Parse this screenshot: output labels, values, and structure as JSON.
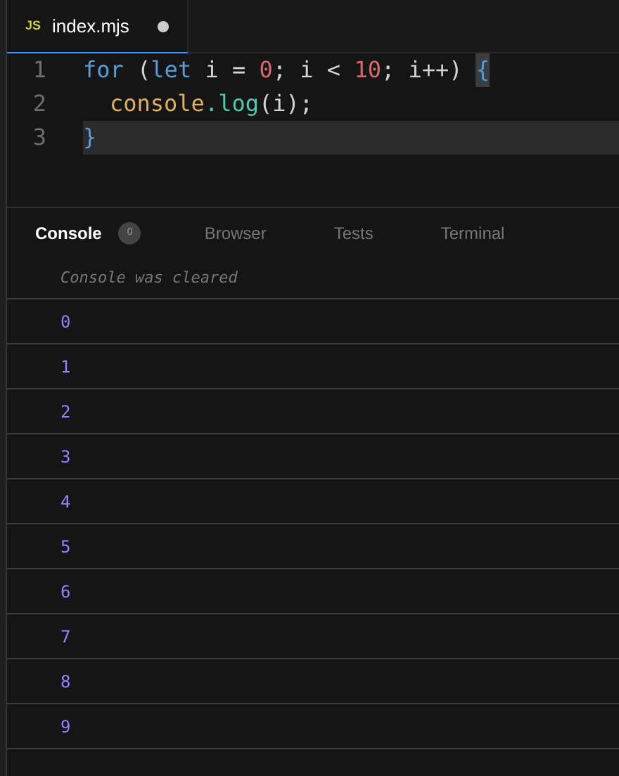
{
  "editor_tabs": [
    {
      "icon": "JS",
      "label": "index.mjs",
      "selected": true,
      "modified": true
    }
  ],
  "code_lines": [
    {
      "number": "1",
      "current": false,
      "tokens": [
        {
          "text": "for",
          "kind": "keyword"
        },
        {
          "text": " (",
          "kind": "plain"
        },
        {
          "text": "let",
          "kind": "keyword"
        },
        {
          "text": " i = ",
          "kind": "plain"
        },
        {
          "text": "0",
          "kind": "number"
        },
        {
          "text": "; i < ",
          "kind": "plain"
        },
        {
          "text": "10",
          "kind": "number"
        },
        {
          "text": "; i++) ",
          "kind": "plain"
        },
        {
          "text": "{",
          "kind": "matched-bracket"
        }
      ]
    },
    {
      "number": "2",
      "current": false,
      "indented": true,
      "tokens": [
        {
          "text": "console",
          "kind": "object"
        },
        {
          "text": ".log",
          "kind": "method"
        },
        {
          "text": "(i);",
          "kind": "plain"
        }
      ]
    },
    {
      "number": "3",
      "current": true,
      "tokens": [
        {
          "text": "}",
          "kind": "bracket"
        }
      ]
    }
  ],
  "panel_tabs": [
    {
      "label": "Console",
      "selected": true,
      "badge": "0"
    },
    {
      "label": "Browser",
      "selected": false
    },
    {
      "label": "Tests",
      "selected": false
    },
    {
      "label": "Terminal",
      "selected": false
    }
  ],
  "console_entries": [
    {
      "text": "Console was cleared",
      "kind": "info"
    },
    {
      "text": "0",
      "kind": "value"
    },
    {
      "text": "1",
      "kind": "value"
    },
    {
      "text": "2",
      "kind": "value"
    },
    {
      "text": "3",
      "kind": "value"
    },
    {
      "text": "4",
      "kind": "value"
    },
    {
      "text": "5",
      "kind": "value"
    },
    {
      "text": "6",
      "kind": "value"
    },
    {
      "text": "7",
      "kind": "value"
    },
    {
      "text": "8",
      "kind": "value"
    },
    {
      "text": "9",
      "kind": "value"
    }
  ]
}
